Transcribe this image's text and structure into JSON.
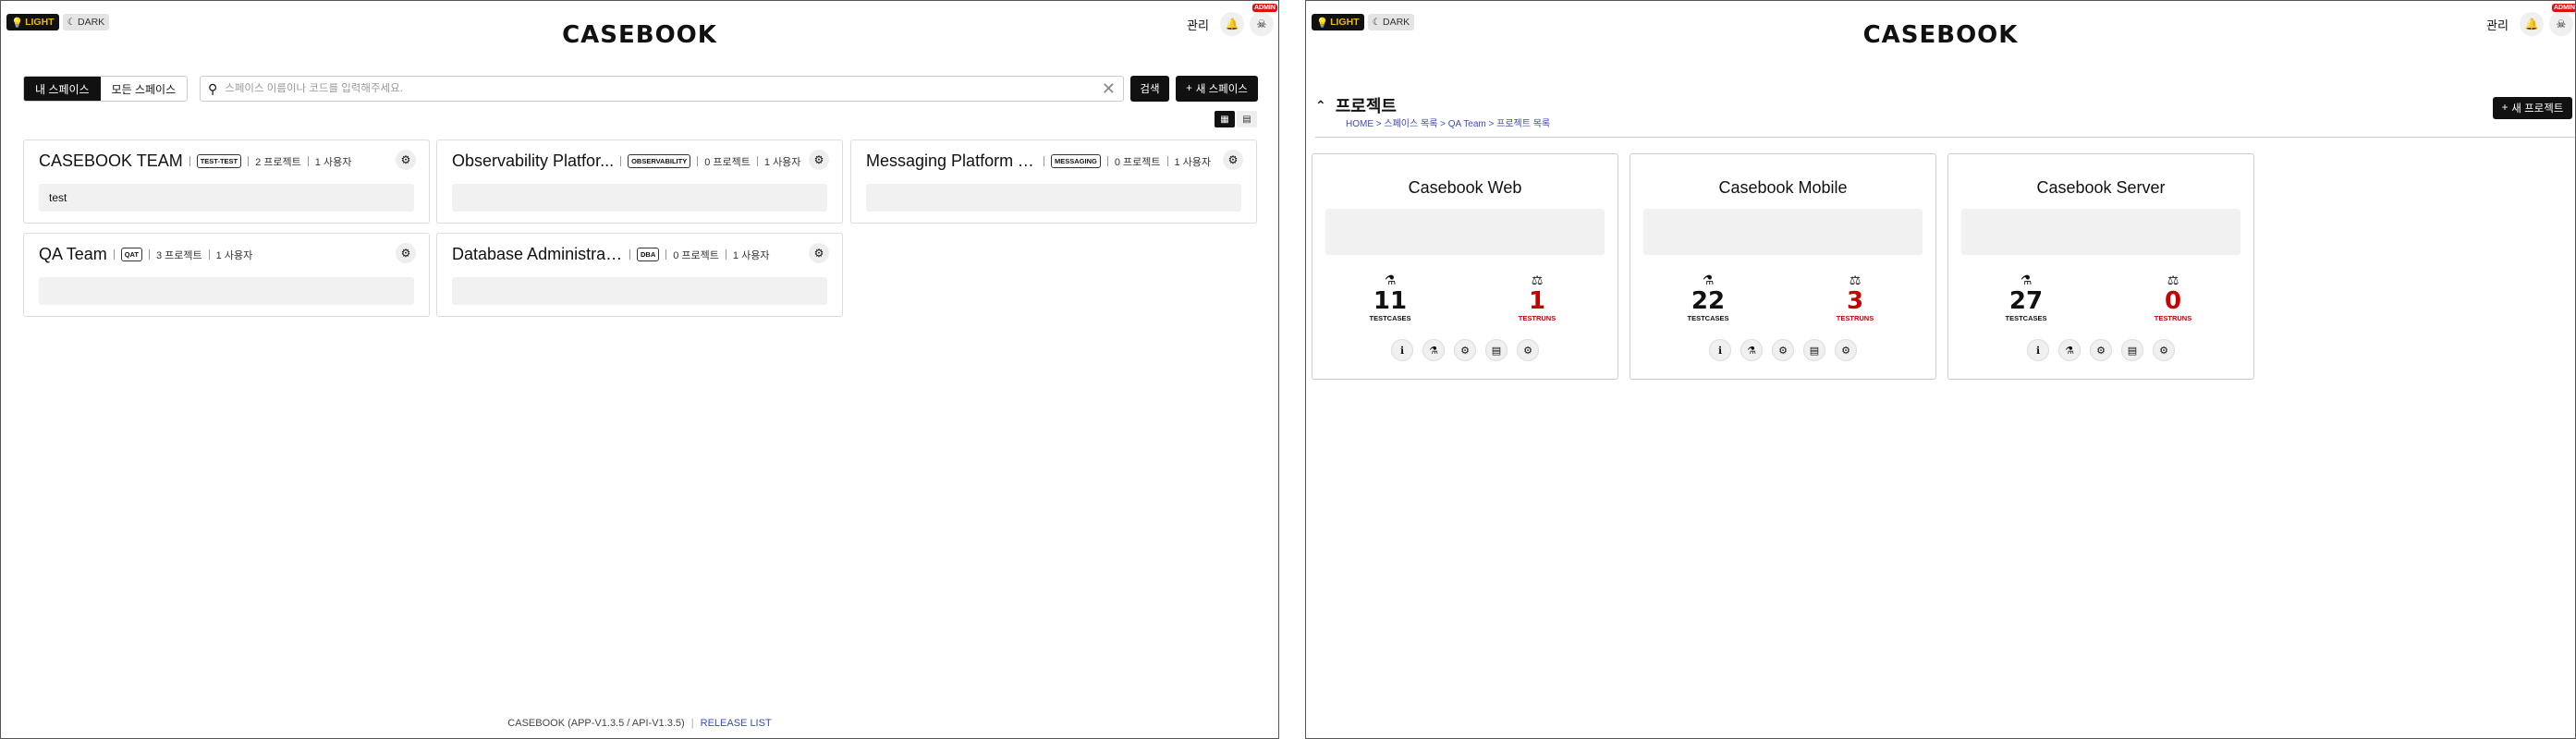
{
  "header": {
    "light_label": "LIGHT",
    "dark_label": "DARK",
    "logo": "CASEBOOK",
    "admin_link": "관리",
    "admin_badge": "ADMIN"
  },
  "spaces_page": {
    "tabs": [
      "내 스페이스",
      "모든 스페이스"
    ],
    "search_placeholder": "스페이스 이름이나 코드를 입력해주세요.",
    "search_button": "검색",
    "new_space_button": "새 스페이스",
    "cards": [
      {
        "name": "CASEBOOK TEAM",
        "code": "TEST-TEST",
        "projects": "2 프로젝트",
        "users": "1 사용자",
        "description": "test"
      },
      {
        "name": "Observability Platfor...",
        "code": "OBSERVABILITY",
        "projects": "0 프로젝트",
        "users": "1 사용자",
        "description": ""
      },
      {
        "name": "Messaging Platform Te...",
        "code": "MESSAGING",
        "projects": "0 프로젝트",
        "users": "1 사용자",
        "description": ""
      },
      {
        "name": "QA Team",
        "code": "QAT",
        "projects": "3 프로젝트",
        "users": "1 사용자",
        "description": ""
      },
      {
        "name": "Database Administration T...",
        "code": "DBA",
        "projects": "0 프로젝트",
        "users": "1 사용자",
        "description": ""
      }
    ],
    "footer_version": "CASEBOOK (APP-V1.3.5 / API-V1.3.5)",
    "footer_release": "RELEASE LIST"
  },
  "projects_page": {
    "title": "프로젝트",
    "breadcrumb": "HOME > 스페이스 목록 > QA Team > 프로젝트 목록",
    "new_project_button": "새 프로젝트",
    "testcases_label": "TESTCASES",
    "testruns_label": "TESTRUNS",
    "projects": [
      {
        "name": "Casebook Web",
        "testcases": "11",
        "testruns": "1"
      },
      {
        "name": "Casebook Mobile",
        "testcases": "22",
        "testruns": "3"
      },
      {
        "name": "Casebook Server",
        "testcases": "27",
        "testruns": "0"
      }
    ]
  },
  "colors": {
    "accent": "#111111",
    "link": "#3c4bb5",
    "danger": "#c40000",
    "highlight": "#f2b705"
  }
}
